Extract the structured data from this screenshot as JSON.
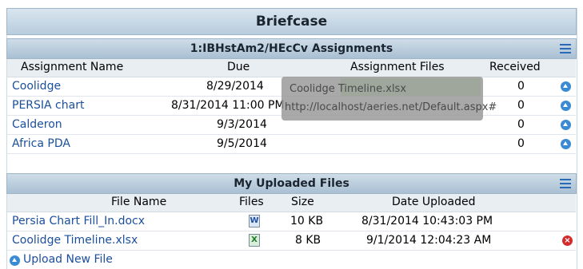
{
  "briefcase": {
    "title": "Briefcase"
  },
  "assignments": {
    "section_title": "1:IBHstAm2/HEcCv Assignments",
    "columns": [
      "Assignment Name",
      "Due",
      "Assignment Files",
      "Received"
    ],
    "rows": [
      {
        "name": "Coolidge",
        "due": "8/29/2014",
        "file": "",
        "received": "0"
      },
      {
        "name": "PERSIA chart",
        "due": "8/31/2014 11:00 PM",
        "file": "",
        "received": "0"
      },
      {
        "name": "Calderon",
        "due": "9/3/2014",
        "file": "",
        "received": "0"
      },
      {
        "name": "Africa PDA",
        "due": "9/5/2014",
        "file": "",
        "received": "0"
      }
    ]
  },
  "uploads": {
    "section_title": "My Uploaded Files",
    "columns": [
      "File Name",
      "Files",
      "Size",
      "Date Uploaded"
    ],
    "rows": [
      {
        "name": "Persia Chart Fill_In.docx",
        "type": "word",
        "size": "10 KB",
        "date": "8/31/2014 10:43:03 PM",
        "icon": "word-doc-icon"
      },
      {
        "name": "Coolidge Timeline.xlsx",
        "type": "excel",
        "size": "8 KB",
        "date": "9/1/2014 12:04:23 AM",
        "icon": "excel-doc-icon"
      }
    ],
    "upload_new": "Upload New File"
  },
  "tooltip": {
    "title": "Coolidge Timeline.xlsx",
    "url": "http://localhost/aeries.net/Default.aspx#"
  },
  "colors": {
    "link": "#1b4f9c",
    "accent": "#2a6bb8",
    "header": "#b9cddd"
  }
}
